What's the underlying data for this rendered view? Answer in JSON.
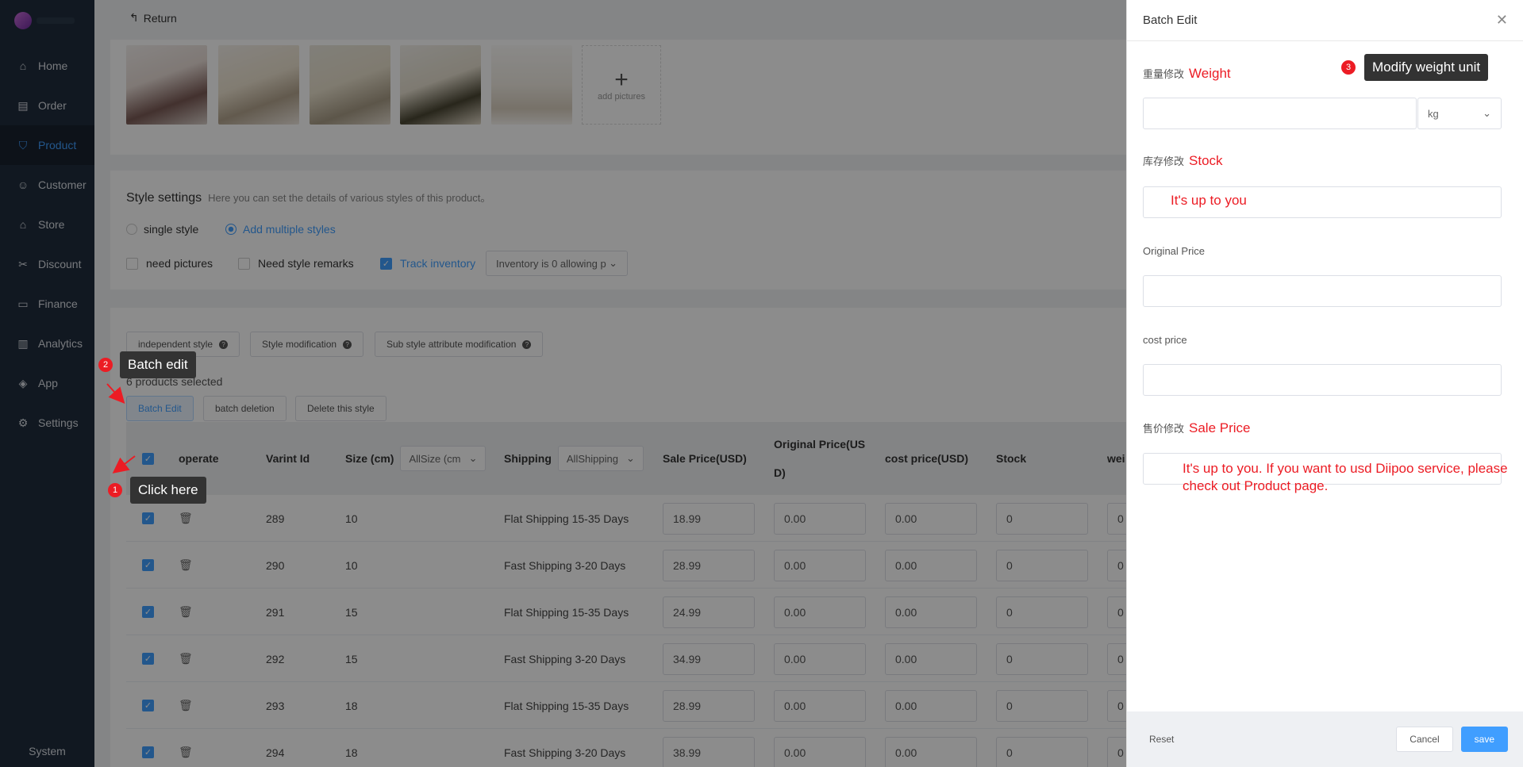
{
  "sidebar": {
    "items": [
      {
        "label": "Home",
        "icon": "home-icon"
      },
      {
        "label": "Order",
        "icon": "order-icon"
      },
      {
        "label": "Product",
        "icon": "product-icon"
      },
      {
        "label": "Customer",
        "icon": "customer-icon"
      },
      {
        "label": "Store",
        "icon": "store-icon"
      },
      {
        "label": "Discount",
        "icon": "discount-icon"
      },
      {
        "label": "Finance",
        "icon": "finance-icon"
      },
      {
        "label": "Analytics",
        "icon": "analytics-icon"
      },
      {
        "label": "App",
        "icon": "app-icon"
      },
      {
        "label": "Settings",
        "icon": "settings-icon"
      }
    ],
    "active": "Product",
    "system_label": "System"
  },
  "header": {
    "return_label": "Return"
  },
  "images": {
    "add_label": "add pictures"
  },
  "style_settings": {
    "title": "Style settings",
    "desc": "Here you can set the details of various styles of this product。",
    "single_style": "single style",
    "multiple_styles": "Add multiple styles",
    "need_pictures": "need pictures",
    "need_remarks": "Need style remarks",
    "track_inventory": "Track inventory",
    "inventory_select": "Inventory is 0 allowing p"
  },
  "variants": {
    "tabs": [
      "independent style",
      "Style modification",
      "Sub style attribute modification"
    ],
    "selected_text": "6 products selected",
    "actions": [
      "Batch Edit",
      "batch deletion",
      "Delete this style"
    ],
    "columns": {
      "operate": "operate",
      "variant_id": "Varint Id",
      "size": "Size (cm)",
      "size_filter": "AllSize (cm",
      "shipping": "Shipping",
      "shipping_filter": "AllShipping",
      "sale_price": "Sale Price(USD)",
      "original_price_1": "Original Price(US",
      "original_price_2": "D)",
      "cost_price": "cost price(USD)",
      "stock": "Stock",
      "weight": "wei"
    },
    "rows": [
      {
        "id": "289",
        "size": "10",
        "shipping": "Flat Shipping 15-35 Days",
        "sale": "18.99",
        "original": "0.00",
        "cost": "0.00",
        "stock": "0",
        "w": "0"
      },
      {
        "id": "290",
        "size": "10",
        "shipping": "Fast Shipping 3-20 Days",
        "sale": "28.99",
        "original": "0.00",
        "cost": "0.00",
        "stock": "0",
        "w": "0"
      },
      {
        "id": "291",
        "size": "15",
        "shipping": "Flat Shipping 15-35 Days",
        "sale": "24.99",
        "original": "0.00",
        "cost": "0.00",
        "stock": "0",
        "w": "0"
      },
      {
        "id": "292",
        "size": "15",
        "shipping": "Fast Shipping 3-20 Days",
        "sale": "34.99",
        "original": "0.00",
        "cost": "0.00",
        "stock": "0",
        "w": "0"
      },
      {
        "id": "293",
        "size": "18",
        "shipping": "Flat Shipping 15-35 Days",
        "sale": "28.99",
        "original": "0.00",
        "cost": "0.00",
        "stock": "0",
        "w": "0"
      },
      {
        "id": "294",
        "size": "18",
        "shipping": "Fast Shipping 3-20 Days",
        "sale": "38.99",
        "original": "0.00",
        "cost": "0.00",
        "stock": "0",
        "w": "0"
      }
    ]
  },
  "annotations": {
    "click_here": {
      "num": "1",
      "text": "Click here"
    },
    "batch_edit": {
      "num": "2",
      "text": "Batch edit"
    },
    "modify_weight": {
      "num": "3",
      "text": "Modify weight unit"
    },
    "weight_note": "Weight",
    "stock_note": "Stock",
    "stock_hint": "It's up to you",
    "sale_note": "Sale Price",
    "sale_hint_1": "It's up to you. If you want to usd Diipoo service, please",
    "sale_hint_2": "check out Product page."
  },
  "drawer": {
    "title": "Batch Edit",
    "weight_label": "重量修改",
    "weight_unit": "kg",
    "stock_label": "库存修改",
    "original_label": "Original Price",
    "cost_label": "cost price",
    "sale_label": "售价修改",
    "reset": "Reset",
    "cancel": "Cancel",
    "save": "save"
  },
  "colors": {
    "accent": "#409eff",
    "annotation": "#ec1c24",
    "sidebar": "#1f2d3d"
  }
}
